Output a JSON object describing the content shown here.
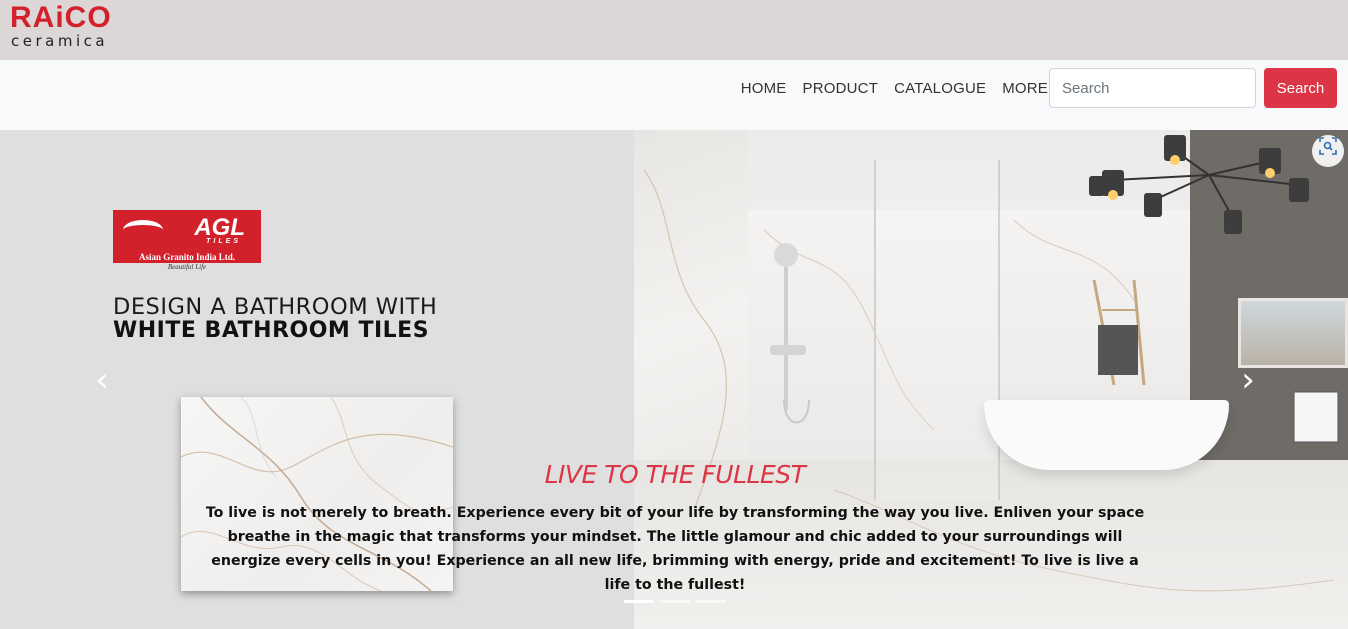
{
  "brand": {
    "name": "RAiCO",
    "tagline": "ceramica",
    "color": "#d3212c"
  },
  "nav": {
    "links": [
      "HOME",
      "PRODUCT",
      "CATALOGUE",
      "MORE"
    ]
  },
  "search": {
    "placeholder": "Search",
    "button_label": "Search",
    "button_color": "#dc3545"
  },
  "hero": {
    "partner_logo": {
      "name": "AGL",
      "sub": "TILES",
      "company": "Asian Granito India Ltd.",
      "tagline": "Beautiful Life"
    },
    "promo_line1": "DESIGN A BATHROOM WITH",
    "promo_line2": "WHITE BATHROOM TILES",
    "caption_title": "LIVE TO THE FULLEST",
    "caption_text": "To live is not merely to breath. Experience every bit of your life by transforming the way you live. Enliven your space breathe in the magic that transforms your mindset. The little glamour and chic added to your surroundings will energize every cells in you! Experience an all new life, brimming with energy, pride and excitement! To live is live a life to the fullest!",
    "caption_color": "#dc3545",
    "slide_count": 3,
    "active_slide": 1,
    "icons": {
      "prev": "chevron-left-icon",
      "next": "chevron-right-icon",
      "zoom": "visual-search-icon"
    }
  }
}
